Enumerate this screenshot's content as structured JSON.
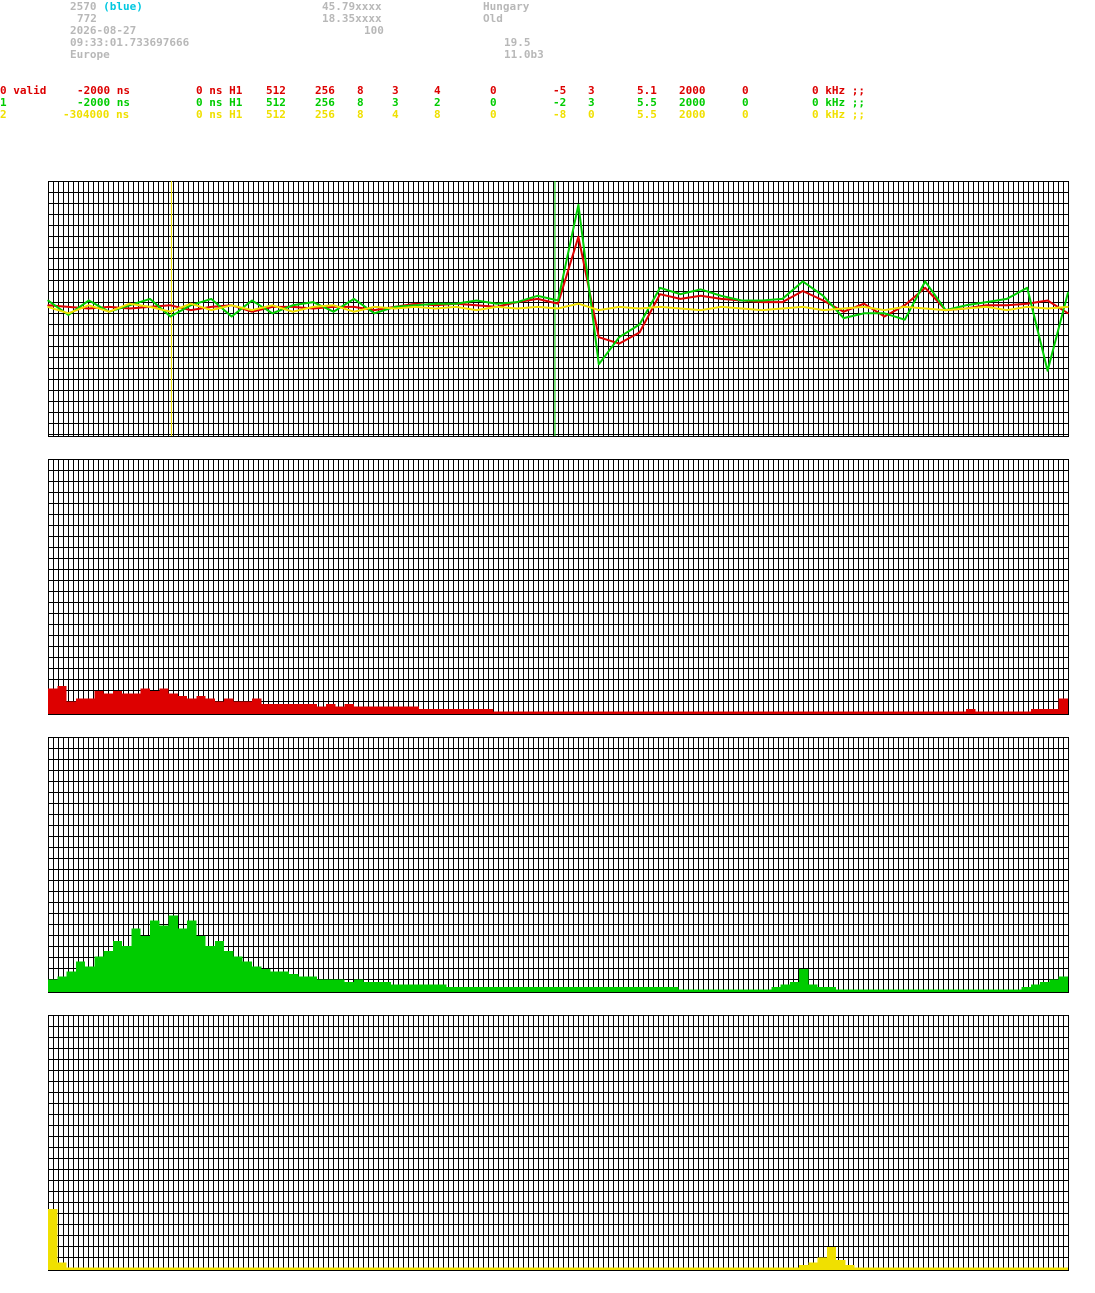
{
  "station": {
    "id": "2570",
    "id_note": "(blue)",
    "count": "772",
    "date": "2026-08-27",
    "time": "09:33:01.733697666",
    "region": "Europe",
    "lat": "45.79xxxx",
    "lon": "18.35xxxx",
    "alt": "100",
    "country": "Hungary",
    "status": "Old",
    "value_a": "19.5",
    "version": "11.0b3"
  },
  "channels": [
    {
      "c0": "0 valid",
      "c1": "-2000 ns",
      "c2": "0 ns H1",
      "c3": "512",
      "c4": "256",
      "c5": "8",
      "c6": "3",
      "c7": "4",
      "c8": "0",
      "c9": "-5",
      "c10": "3",
      "c11": "5.1",
      "c12": "2000",
      "c13": "0",
      "c14": "0 kHz ;;"
    },
    {
      "c0": "1",
      "c1": "-2000 ns",
      "c2": "0 ns H1",
      "c3": "512",
      "c4": "256",
      "c5": "8",
      "c6": "3",
      "c7": "2",
      "c8": "0",
      "c9": "-2",
      "c10": "3",
      "c11": "5.5",
      "c12": "2000",
      "c13": "0",
      "c14": "0 kHz ;;"
    },
    {
      "c0": "2",
      "c1": "-304000 ns",
      "c2": "0 ns H1",
      "c3": "512",
      "c4": "256",
      "c5": "8",
      "c6": "4",
      "c7": "8",
      "c8": "0",
      "c9": "-8",
      "c10": "0",
      "c11": "5.5",
      "c12": "2000",
      "c13": "0",
      "c14": "0 kHz ;;"
    }
  ],
  "colors": {
    "grid": "#000000",
    "ch0": "#dd0000",
    "ch1": "#00cc00",
    "ch2": "#f0e000",
    "highlight": "#00c8e0"
  },
  "chart_data": [
    {
      "type": "line",
      "title": "",
      "grid": true,
      "x": [
        0,
        2,
        4,
        6,
        8,
        10,
        12,
        14,
        16,
        18,
        20,
        22,
        24,
        26,
        28,
        30,
        32,
        34,
        36,
        38,
        40,
        42,
        44,
        46,
        48,
        50,
        52,
        54,
        56,
        58,
        60,
        62,
        64,
        66,
        68,
        70,
        72,
        74,
        76,
        78,
        80,
        82,
        84,
        86,
        88,
        90,
        92,
        94,
        96,
        98,
        100
      ],
      "ylim": [
        -8,
        8
      ],
      "markers": [
        {
          "x": 12.1,
          "color": "#f0e000"
        },
        {
          "x": 49.7,
          "color": "#00cc00"
        }
      ],
      "series": [
        {
          "color": "#dd0000",
          "values": [
            0.2,
            0.1,
            0,
            0.1,
            0,
            0.1,
            0.2,
            -0.1,
            0.1,
            0.2,
            -0.2,
            0.1,
            0.1,
            0,
            0.1,
            0.1,
            -0.1,
            0.1,
            0.3,
            0.2,
            0.3,
            0.2,
            0.1,
            0.4,
            0.6,
            0.3,
            4.5,
            -1.8,
            -2.2,
            -1.5,
            0.9,
            0.6,
            0.8,
            0.6,
            0.5,
            0.4,
            0.4,
            1.1,
            0.5,
            -0.2,
            0.3,
            -0.5,
            0.2,
            1.3,
            -0.1,
            0,
            0.2,
            0.2,
            0.3,
            0.5,
            -0.3
          ]
        },
        {
          "color": "#00cc00",
          "values": [
            0.5,
            -0.4,
            0.5,
            -0.2,
            0.2,
            0.6,
            -0.5,
            0.2,
            0.6,
            -0.5,
            0.5,
            -0.3,
            0.2,
            0.4,
            -0.2,
            0.6,
            -0.3,
            0.1,
            0.2,
            0.3,
            0.3,
            0.5,
            0.3,
            0.4,
            0.8,
            0.5,
            6.5,
            -3.5,
            -1.8,
            -1.0,
            1.3,
            0.9,
            1.2,
            0.8,
            0.5,
            0.5,
            0.6,
            1.7,
            0.8,
            -0.6,
            -0.3,
            -0.3,
            -0.7,
            1.7,
            -0.1,
            0.2,
            0.4,
            0.6,
            1.3,
            -3.9,
            1.0
          ]
        },
        {
          "color": "#f0e000",
          "values": [
            0.1,
            -0.3,
            0.2,
            -0.2,
            0.3,
            0.1,
            -0.2,
            0.3,
            -0.1,
            0.2,
            -0.1,
            0.2,
            -0.2,
            0.1,
            0.2,
            -0.2,
            0.1,
            0,
            0.1,
            0,
            0.1,
            -0.1,
            0.1,
            0,
            0.1,
            0,
            0.3,
            -0.1,
            0.1,
            0,
            0.1,
            0,
            -0.1,
            0.1,
            0,
            -0.1,
            0,
            0.1,
            -0.1,
            0,
            0.1,
            -0.1,
            0.1,
            0,
            -0.1,
            0,
            0.1,
            -0.1,
            0.1,
            0,
            0.1
          ]
        }
      ]
    },
    {
      "type": "bar",
      "title": "",
      "grid": true,
      "color": "#dd0000",
      "ylim": [
        0,
        100
      ],
      "values": [
        10,
        11,
        5,
        6,
        6,
        9,
        8,
        9,
        8,
        8,
        10,
        9,
        10,
        8,
        7,
        6,
        7,
        6,
        5,
        6,
        5,
        5,
        6,
        4,
        4,
        4,
        4,
        4,
        4,
        3,
        4,
        3,
        4,
        3,
        3,
        3,
        3,
        3,
        3,
        3,
        2,
        2,
        2,
        2,
        2,
        2,
        2,
        2,
        1,
        1,
        1,
        1,
        1,
        1,
        1,
        1,
        1,
        1,
        1,
        1,
        1,
        1,
        1,
        1,
        1,
        1,
        1,
        1,
        1,
        1,
        1,
        1,
        1,
        1,
        1,
        1,
        1,
        1,
        1,
        1,
        1,
        1,
        1,
        1,
        1,
        1,
        1,
        1,
        1,
        1,
        1,
        1,
        1,
        1,
        1,
        1,
        1,
        1,
        1,
        2,
        1,
        1,
        1,
        1,
        1,
        1,
        2,
        2,
        2,
        6
      ]
    },
    {
      "type": "bar",
      "title": "",
      "grid": true,
      "color": "#00cc00",
      "ylim": [
        0,
        100
      ],
      "values": [
        5,
        6,
        8,
        12,
        10,
        14,
        16,
        20,
        18,
        25,
        22,
        28,
        26,
        30,
        25,
        28,
        22,
        18,
        20,
        16,
        14,
        12,
        10,
        9,
        8,
        8,
        7,
        6,
        6,
        5,
        5,
        5,
        4,
        5,
        4,
        4,
        4,
        3,
        3,
        3,
        3,
        3,
        3,
        2,
        2,
        2,
        2,
        2,
        2,
        2,
        2,
        2,
        2,
        2,
        2,
        2,
        2,
        2,
        2,
        2,
        2,
        2,
        2,
        2,
        2,
        2,
        2,
        2,
        1,
        1,
        1,
        1,
        1,
        1,
        1,
        1,
        1,
        1,
        2,
        3,
        4,
        9,
        3,
        2,
        2,
        1,
        1,
        1,
        1,
        1,
        1,
        1,
        1,
        1,
        1,
        1,
        1,
        1,
        1,
        1,
        1,
        1,
        1,
        1,
        1,
        2,
        3,
        4,
        5,
        6
      ]
    },
    {
      "type": "bar",
      "title": "",
      "grid": true,
      "color": "#f0e000",
      "ylim": [
        0,
        100
      ],
      "values": [
        24,
        3,
        1,
        1,
        1,
        1,
        1,
        1,
        1,
        1,
        1,
        1,
        1,
        1,
        1,
        1,
        1,
        1,
        1,
        1,
        1,
        1,
        1,
        1,
        1,
        1,
        1,
        1,
        1,
        1,
        1,
        1,
        1,
        1,
        1,
        1,
        1,
        1,
        1,
        1,
        1,
        1,
        1,
        1,
        1,
        1,
        1,
        1,
        1,
        1,
        1,
        1,
        1,
        1,
        1,
        1,
        1,
        1,
        1,
        1,
        1,
        1,
        1,
        1,
        1,
        1,
        1,
        1,
        1,
        1,
        1,
        1,
        1,
        1,
        1,
        1,
        1,
        1,
        1,
        1,
        1,
        2,
        3,
        5,
        9,
        4,
        2,
        1,
        1,
        1,
        1,
        1,
        1,
        1,
        1,
        1,
        1,
        1,
        1,
        1,
        1,
        1,
        1,
        1,
        1,
        1,
        1,
        1,
        1,
        1
      ]
    }
  ]
}
